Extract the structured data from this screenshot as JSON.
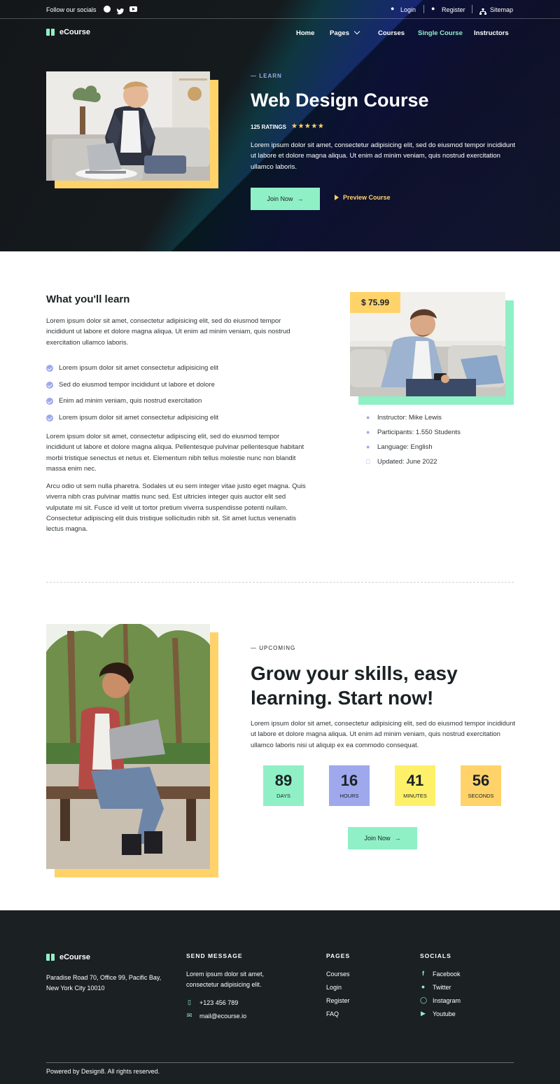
{
  "topbar": {
    "follow": "Follow our socials",
    "login": "Login",
    "register": "Register",
    "sitemap": "Sitemap"
  },
  "brand": {
    "name": "eCourse"
  },
  "nav": {
    "home": "Home",
    "pages": "Pages",
    "courses": "Courses",
    "single_course": "Single Course",
    "instructors": "Instructors"
  },
  "hero": {
    "eyebrow": "— LEARN",
    "title": "Web Design Course",
    "ratings": "125 RATINGS",
    "stars": "★★★★★",
    "rating_value": 5,
    "desc": "Lorem ipsum dolor sit amet, consectetur adipisicing elit, sed do eiusmod tempor incididunt ut labore et dolore magna aliqua. Ut enim ad minim veniam, quis nostrud exercitation ullamco laboris.",
    "join": "Join Now",
    "preview": "Preview Course"
  },
  "learn": {
    "title": "What you'll learn",
    "intro": "Lorem ipsum dolor sit amet, consectetur adipisicing elit, sed do eiusmod tempor incididunt ut labore et dolore magna aliqua. Ut enim ad minim veniam, quis nostrud exercitation ullamco laboris.",
    "bullets": [
      "Lorem ipsum dolor sit amet consectetur adipisicing elit",
      "Sed do eiusmod tempor incididunt ut labore et dolore",
      "Enim ad minim veniam, quis nostrud exercitation",
      "Lorem ipsum dolor sit amet consectetur adipisicing elit"
    ],
    "p2": "Lorem ipsum dolor sit amet, consectetur adipiscing elit, sed do eiusmod tempor incididunt ut labore et dolore magna aliqua. Pellentesque pulvinar pellentesque habitant morbi tristique senectus et netus et. Elementum nibh tellus molestie nunc non blandit massa enim nec.",
    "p3": "Arcu odio ut sem nulla pharetra. Sodales ut eu sem integer vitae justo eget magna. Quis viverra nibh cras pulvinar mattis nunc sed. Est ultricies integer quis auctor elit sed vulputate mi sit. Fusce id velit ut tortor pretium viverra suspendisse potenti nullam. Consectetur adipiscing elit duis tristique sollicitudin nibh sit. Sit amet luctus venenatis lectus magna."
  },
  "course": {
    "price": "$ 75.99",
    "instructor": "Instructor: Mike Lewis",
    "participants": "Participants: 1.550 Students",
    "language": "Language: English",
    "updated": "Updated: June 2022"
  },
  "upcoming": {
    "eyebrow": "— UPCOMING",
    "title1": "Grow your skills, easy",
    "title2": "learning. Start now!",
    "desc": "Lorem ipsum dolor sit amet, consectetur adipisicing elit, sed do eiusmod tempor incididunt ut labore et dolore magna aliqua. Ut enim ad minim veniam, quis nostrud exercitation ullamco laboris nisi ut aliquip ex ea commodo consequat.",
    "countdown": [
      {
        "n": "89",
        "l": "DAYS",
        "color": "#8ff0c6"
      },
      {
        "n": "16",
        "l": "HOURS",
        "color": "#9fa8ec"
      },
      {
        "n": "41",
        "l": "MINUTES",
        "color": "#fff06a"
      },
      {
        "n": "56",
        "l": "SECONDS",
        "color": "#ffd36a"
      }
    ],
    "join": "Join Now"
  },
  "footer": {
    "address": "Paradise Road 70, Office 99, Pacific Bay,  New York City 10010",
    "send_title": "SEND MESSAGE",
    "send_desc": "Lorem ipsum dolor sit amet, consectetur adipisicing elit.",
    "phone": "+123 456 789",
    "email": "mail@ecourse.io",
    "pages_title": "PAGES",
    "pages": [
      "Courses",
      "Login",
      "Register",
      "FAQ"
    ],
    "socials_title": "SOCIALS",
    "socials": [
      "Facebook",
      "Twitter",
      "Instagram",
      "Youtube"
    ],
    "copyright": "Powered by Design8. All rights reserved."
  },
  "colors": {
    "mint": "#8ff0c6",
    "yellow": "#ffd36a",
    "periwinkle": "#9fa8ec",
    "dark": "#1b2022"
  }
}
